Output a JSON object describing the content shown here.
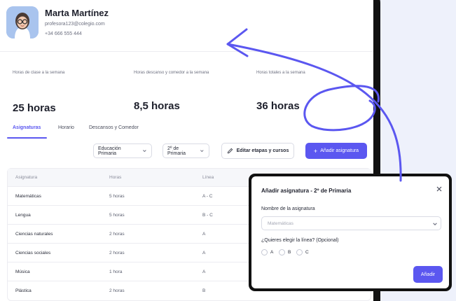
{
  "profile": {
    "name": "Marta Martínez",
    "email": "profesora123@colegio.com",
    "phone": "+34 666 555 444"
  },
  "stats": [
    {
      "label": "Horas de clase a la semana",
      "value": "25 horas"
    },
    {
      "label": "Horas descanso y comedor a la semana",
      "value": "8,5 horas"
    },
    {
      "label": "Horas totales a la semana",
      "value": "36 horas"
    }
  ],
  "tabs": [
    {
      "label": "Asignaturas",
      "active": true
    },
    {
      "label": "Horario",
      "active": false
    },
    {
      "label": "Descansos y Comedor",
      "active": false
    }
  ],
  "toolbar": {
    "level_select": "Educación Primaria",
    "grade_select": "2º de Primaria",
    "edit_label": "Editar etapas y cursos",
    "add_label": "Añadir asignatura"
  },
  "table": {
    "headers": [
      "Asignatura",
      "Horas",
      "Línea"
    ],
    "rows": [
      {
        "subject": "Matemáticas",
        "hours": "5 horas",
        "line": "A - C"
      },
      {
        "subject": "Lengua",
        "hours": "5 horas",
        "line": "B - C"
      },
      {
        "subject": "Ciencias naturales",
        "hours": "2 horas",
        "line": "A"
      },
      {
        "subject": "Ciencias sociales",
        "hours": "2 horas",
        "line": "A"
      },
      {
        "subject": "Música",
        "hours": "1 hora",
        "line": "A"
      },
      {
        "subject": "Plástica",
        "hours": "2 horas",
        "line": "B"
      }
    ]
  },
  "modal": {
    "title": "Añadir asignatura - 2º de Primaria",
    "subject_label": "Nombre de la asignatura",
    "subject_placeholder": "Matemáticas",
    "line_label": "¿Quieres elegir la línea? (Opcional)",
    "line_options": [
      "A",
      "B",
      "C"
    ],
    "submit_label": "Añadir"
  },
  "colors": {
    "accent": "#5b57f0",
    "annotation": "#5b57f0",
    "frame": "#111111",
    "side_panel": "#eef1fb"
  }
}
